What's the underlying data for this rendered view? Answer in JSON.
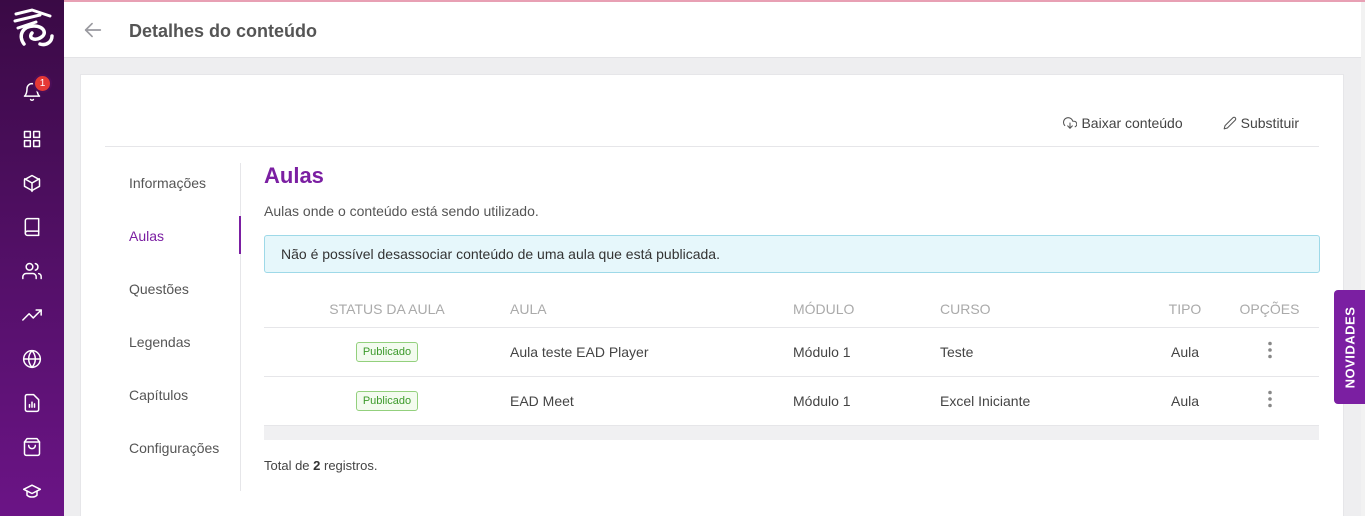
{
  "sidebar": {
    "notification_count": "1",
    "items": [
      {
        "icon": "bell-icon"
      },
      {
        "icon": "grid-icon"
      },
      {
        "icon": "cube-icon"
      },
      {
        "icon": "book-icon"
      },
      {
        "icon": "users-icon"
      },
      {
        "icon": "trending-icon"
      },
      {
        "icon": "globe-icon"
      },
      {
        "icon": "report-icon"
      },
      {
        "icon": "shopping-bag-icon"
      },
      {
        "icon": "graduation-cap-icon"
      }
    ]
  },
  "header": {
    "title": "Detalhes do conteúdo"
  },
  "actions": {
    "download_label": "Baixar conteúdo",
    "replace_label": "Substituir"
  },
  "tabs": [
    {
      "label": "Informações",
      "active": false
    },
    {
      "label": "Aulas",
      "active": true
    },
    {
      "label": "Questões",
      "active": false
    },
    {
      "label": "Legendas",
      "active": false
    },
    {
      "label": "Capítulos",
      "active": false
    },
    {
      "label": "Configurações",
      "active": false
    }
  ],
  "section": {
    "title": "Aulas",
    "description": "Aulas onde o conteúdo está sendo utilizado.",
    "alert": "Não é possível desassociar conteúdo de uma aula que está publicada."
  },
  "table": {
    "columns": [
      "STATUS DA AULA",
      "AULA",
      "MÓDULO",
      "CURSO",
      "TIPO",
      "OPÇÕES"
    ],
    "rows": [
      {
        "status": "Publicado",
        "aula": "Aula teste EAD Player",
        "modulo": "Módulo 1",
        "curso": "Teste",
        "tipo": "Aula"
      },
      {
        "status": "Publicado",
        "aula": "EAD Meet",
        "modulo": "Módulo 1",
        "curso": "Excel Iniciante",
        "tipo": "Aula"
      }
    ]
  },
  "footer": {
    "total_prefix": "Total de ",
    "total_count": "2",
    "total_suffix": " registros."
  },
  "novidades_label": "NOVIDADES",
  "colors": {
    "accent": "#7b1fa2",
    "sidebar": "#4a0e58",
    "badge_green": "#3c9a2b",
    "alert_bg": "#e6f7fb"
  }
}
